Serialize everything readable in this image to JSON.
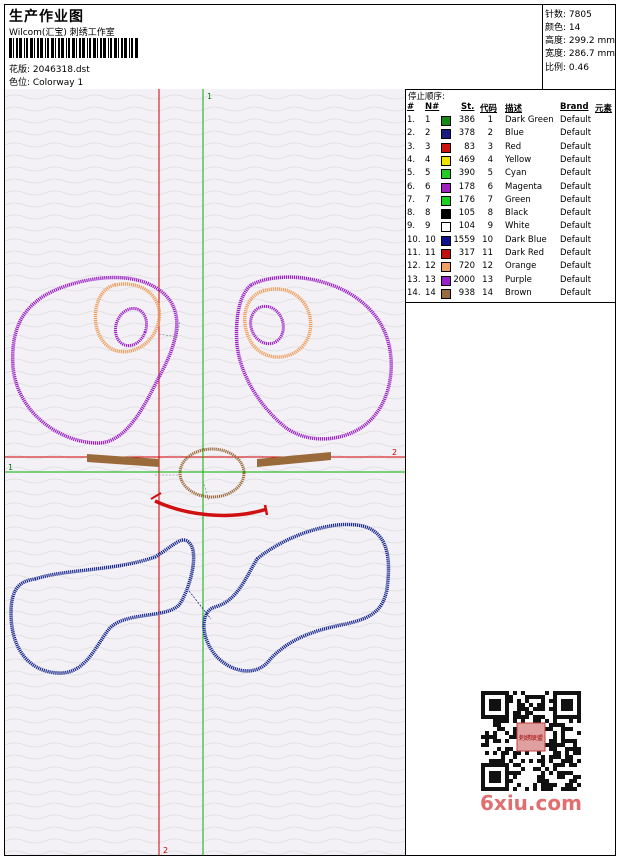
{
  "header": {
    "title": "生产作业图",
    "company": "Wilcom(汇宝) 刺绣工作室",
    "design_label": "花版: 2046318.dst",
    "colorway_label": "色位: Colorway 1"
  },
  "stats": {
    "stitches": "针数: 7805",
    "colors": "颜色: 14",
    "height": "高度: 299.2 mm",
    "width": "宽度: 286.7 mm",
    "scale": "比例: 0.46"
  },
  "design": {
    "axis_marks": {
      "v1": "1",
      "h2": "2",
      "h1": "1",
      "v2": "2"
    },
    "colors": {
      "purple": "#9b1fc4",
      "orange": "#f0a060",
      "brown": "#9a6a3a",
      "red": "#d01010",
      "blue": "#1a2a90",
      "green": "#00b000",
      "redline": "#d00000"
    }
  },
  "legend": {
    "heading": "停止顺序:",
    "columns": [
      "#",
      "N#",
      "St.",
      "代码",
      "描述",
      "Brand",
      "元素"
    ],
    "rows": [
      {
        "idx": "1.",
        "n": "1",
        "color": "#138a13",
        "st": "386",
        "code": "1",
        "desc": "Dark Green",
        "brand": "Default"
      },
      {
        "idx": "2.",
        "n": "2",
        "color": "#1a1a80",
        "st": "378",
        "code": "2",
        "desc": "Blue",
        "brand": "Default"
      },
      {
        "idx": "3.",
        "n": "3",
        "color": "#cc1111",
        "st": "83",
        "code": "3",
        "desc": "Red",
        "brand": "Default"
      },
      {
        "idx": "4.",
        "n": "4",
        "color": "#f2e200",
        "st": "469",
        "code": "4",
        "desc": "Yellow",
        "brand": "Default"
      },
      {
        "idx": "5.",
        "n": "5",
        "color": "#22cc22",
        "st": "390",
        "code": "5",
        "desc": "Cyan",
        "brand": "Default"
      },
      {
        "idx": "6.",
        "n": "6",
        "color": "#a020c0",
        "st": "178",
        "code": "6",
        "desc": "Magenta",
        "brand": "Default"
      },
      {
        "idx": "7.",
        "n": "7",
        "color": "#20d020",
        "st": "176",
        "code": "7",
        "desc": "Green",
        "brand": "Default"
      },
      {
        "idx": "8.",
        "n": "8",
        "color": "#000000",
        "st": "105",
        "code": "8",
        "desc": "Black",
        "brand": "Default"
      },
      {
        "idx": "9.",
        "n": "9",
        "color": "#ffffff",
        "st": "104",
        "code": "9",
        "desc": "White",
        "brand": "Default"
      },
      {
        "idx": "10.",
        "n": "10",
        "color": "#10108a",
        "st": "1559",
        "code": "10",
        "desc": "Dark Blue",
        "brand": "Default"
      },
      {
        "idx": "11.",
        "n": "11",
        "color": "#c01010",
        "st": "317",
        "code": "11",
        "desc": "Dark Red",
        "brand": "Default"
      },
      {
        "idx": "12.",
        "n": "12",
        "color": "#f0a060",
        "st": "720",
        "code": "12",
        "desc": "Orange",
        "brand": "Default"
      },
      {
        "idx": "13.",
        "n": "13",
        "color": "#9a20c8",
        "st": "2000",
        "code": "13",
        "desc": "Purple",
        "brand": "Default"
      },
      {
        "idx": "14.",
        "n": "14",
        "color": "#9a6a3a",
        "st": "938",
        "code": "14",
        "desc": "Brown",
        "brand": "Default"
      }
    ]
  },
  "watermark": {
    "text": "6xiu.com",
    "qr_caption": "刺绣联盟"
  }
}
